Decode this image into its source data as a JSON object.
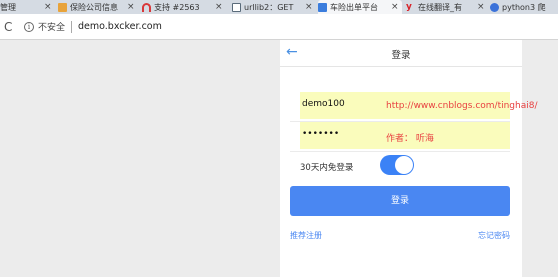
{
  "browser": {
    "tabs": [
      {
        "title": "管理",
        "icon": "none",
        "color": "#d5dbe3"
      },
      {
        "title": "保险公司信息",
        "icon": "page-icon",
        "color": "#e8a33b"
      },
      {
        "title": "支持 #2563",
        "icon": "arc-icon",
        "color": "#d9383a"
      },
      {
        "title": "urllib2：GET",
        "icon": "doc-icon",
        "color": "#5a6b7a"
      },
      {
        "title": "车险出单平台",
        "icon": "app-icon",
        "color": "#3b7ddd",
        "active": true
      },
      {
        "title": "在线翻译_有",
        "icon": "youdao-icon",
        "color": "#d8232a"
      },
      {
        "title": "python3 爬",
        "icon": "paw-icon",
        "color": "#3b72d9"
      }
    ],
    "close_glyph": "×",
    "reload_glyph": "C",
    "security_label": "不安全",
    "url": "demo.bxcker.com"
  },
  "page": {
    "title": "登录",
    "back_glyph": "←",
    "username_value": "demo100",
    "password_value": "•••••••",
    "watermark_line1": "http://www.cnblogs.com/tinghai8/",
    "watermark_line2": "作者：  听海",
    "remember_label": "30天内免登录",
    "remember_on": true,
    "login_button": "登录",
    "register_link": "推荐注册",
    "forgot_link": "忘记密码",
    "accent_color": "#4a87f2",
    "highlight_color": "#fafcbc",
    "watermark_color": "#e84040"
  }
}
